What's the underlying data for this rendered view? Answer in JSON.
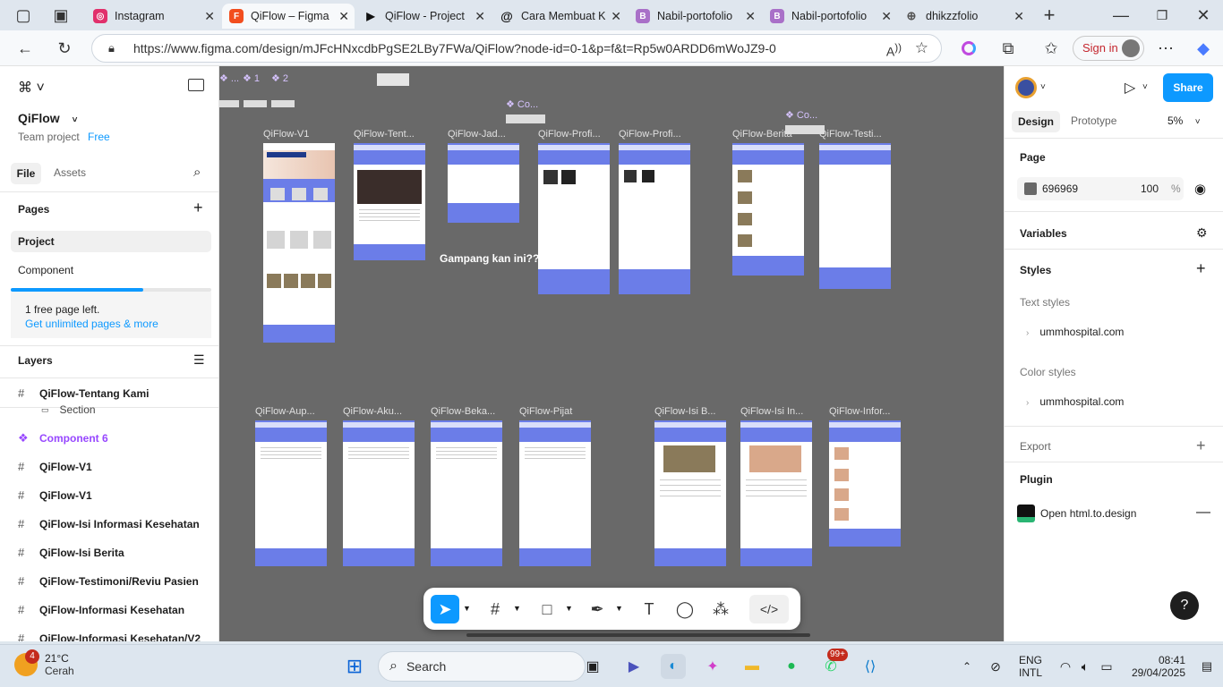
{
  "tabs": [
    {
      "label": "Instagram",
      "icon": "instagram-icon",
      "color": "#e1306c"
    },
    {
      "label": "QiFlow – Figma",
      "icon": "figma-icon",
      "color": "#f24e1e"
    },
    {
      "label": "QiFlow - Project",
      "icon": "play-icon",
      "color": "#111111"
    },
    {
      "label": "Cara Membuat K",
      "icon": "threads-icon",
      "color": "#111111"
    },
    {
      "label": "Nabil-portofolio",
      "icon": "b-icon",
      "color": "#a970c8"
    },
    {
      "label": "Nabil-portofolio",
      "icon": "b-icon",
      "color": "#a970c8"
    },
    {
      "label": "dhikzzfolio",
      "icon": "globe-icon",
      "color": "#555555"
    }
  ],
  "browser": {
    "url": "https://www.figma.com/design/mJFcHNxcdbPgSE2LBy7FWa/QiFlow?node-id=0-1&p=f&t=Rp5w0ARDD6mWoJZ9-0",
    "sign_in": "Sign in"
  },
  "left": {
    "file_name": "QiFlow",
    "team": "Team project",
    "plan": "Free",
    "tab_file": "File",
    "tab_assets": "Assets",
    "pages_title": "Pages",
    "pages": [
      "Project",
      "Component"
    ],
    "free_left": "1 free page left.",
    "unlimited": "Get unlimited pages & more",
    "layers_title": "Layers",
    "layers": [
      "QiFlow-Tentang Kami",
      "Section",
      "Component 6",
      "QiFlow-V1",
      "QiFlow-V1",
      "QiFlow-Isi Informasi Kesehatan",
      "QiFlow-Isi Berita",
      "QiFlow-Testimoni/Reviu Pasien",
      "QiFlow-Informasi Kesehatan",
      "QiFlow-Informasi Kesehatan/V2"
    ]
  },
  "canvas": {
    "top_labels": [
      "...",
      "1",
      "2"
    ],
    "co_label": "Co...",
    "row1": [
      "QiFlow-V1",
      "QiFlow-Tent...",
      "QiFlow-Jad...",
      "QiFlow-Profi...",
      "QiFlow-Profi...",
      "QiFlow-Berita",
      "QiFlow-Testi..."
    ],
    "row2": [
      "QiFlow-Aup...",
      "QiFlow-Aku...",
      "QiFlow-Beka...",
      "QiFlow-Pijat",
      "QiFlow-Isi B...",
      "QiFlow-Isi In...",
      "QiFlow-Infor..."
    ],
    "gampang": "Gampang kan ini??"
  },
  "right": {
    "tab_design": "Design",
    "tab_prototype": "Prototype",
    "zoom": "5%",
    "share": "Share",
    "page_title": "Page",
    "page_color": "696969",
    "page_opacity": "100",
    "percent": "%",
    "variables": "Variables",
    "styles": "Styles",
    "text_styles": "Text styles",
    "text_style_item": "ummhospital.com",
    "color_styles": "Color styles",
    "color_style_item": "ummhospital.com",
    "export": "Export",
    "plugin": "Plugin",
    "plugin_item": "Open html.to.design",
    "help": "?"
  },
  "taskbar": {
    "temp": "21°C",
    "weather": "Cerah",
    "weather_badge": "4",
    "search": "Search",
    "lang1": "ENG",
    "lang2": "INTL",
    "time": "08:41",
    "date": "29/04/2025",
    "notif_badge": "99+"
  }
}
